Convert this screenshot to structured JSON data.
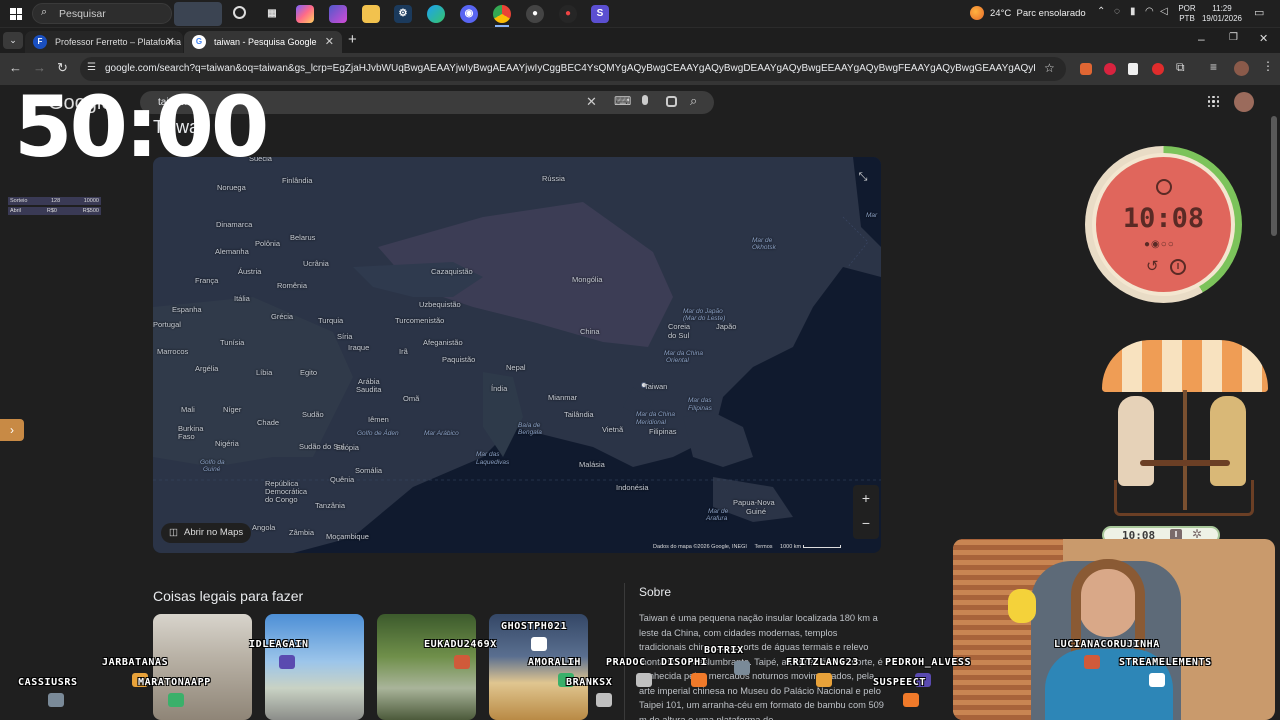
{
  "taskbar": {
    "search_placeholder": "Pesquisar",
    "weather": "24°C  Parc ensolarado",
    "lang_top": "POR",
    "lang_bottom": "PTB",
    "time": "11:29",
    "date": "19/01/2026"
  },
  "tabs": [
    {
      "label": "Professor Ferretto – Plataforma",
      "favicon": "F"
    },
    {
      "label": "taiwan - Pesquisa Google",
      "favicon": "G"
    }
  ],
  "address": {
    "url": "google.com/search?q=taiwan&oq=taiwan&gs_lcrp=EgZjaHJvbWUqBwgAEAAYjwIyBwgAEAAYjwIyCggBEC4YsQMYgAQyBwgCEAAYgAQyBwgDEAAYgAQyBwgEEAAYgAQyBwgFEAAYgAQyBwgGEAAYgAQyBwgHEAAYgAQyBwgIEA..."
  },
  "search": {
    "logo": "Google",
    "query": "taiwan"
  },
  "kp": {
    "title": "Taiwan"
  },
  "overlay": {
    "big_timer": "50:00",
    "stats": [
      [
        "Sorteio",
        "128",
        "10000"
      ],
      [
        "Abril",
        "R$0",
        "R$500"
      ]
    ],
    "pomodoro_time": "10:08",
    "mini_timer": "10:08"
  },
  "map": {
    "open_in_maps": "Abrir no Maps",
    "attribution": "Dados do mapa ©2026 Google, INEGI",
    "terms": "Termos",
    "scale": "1000 km",
    "labels": [
      [
        "Suécia",
        249,
        154,
        ""
      ],
      [
        "Finlândia",
        282,
        176,
        ""
      ],
      [
        "Rússia",
        542,
        174,
        ""
      ],
      [
        "Noruega",
        217,
        183,
        ""
      ],
      [
        "Dinamarca",
        216,
        220,
        ""
      ],
      [
        "Belarus",
        290,
        233,
        ""
      ],
      [
        "Polônia",
        255,
        239,
        ""
      ],
      [
        "Alemanha",
        215,
        247,
        ""
      ],
      [
        "Ucrânia",
        303,
        259,
        ""
      ],
      [
        "Áustria",
        238,
        267,
        ""
      ],
      [
        "Cazaquistão",
        431,
        267,
        ""
      ],
      [
        "França",
        195,
        276,
        ""
      ],
      [
        "Romênia",
        277,
        281,
        ""
      ],
      [
        "Mongólia",
        572,
        275,
        ""
      ],
      [
        "Itália",
        234,
        294,
        ""
      ],
      [
        "Uzbequistão",
        419,
        300,
        ""
      ],
      [
        "Espanha",
        172,
        305,
        ""
      ],
      [
        "Grécia",
        271,
        312,
        ""
      ],
      [
        "Turquia",
        318,
        316,
        ""
      ],
      [
        "Turcomenistão",
        395,
        316,
        ""
      ],
      [
        "Portugal",
        153,
        320,
        ""
      ],
      [
        "Coreia",
        668,
        322,
        ""
      ],
      [
        "do Sul",
        668,
        331,
        ""
      ],
      [
        "Japão",
        716,
        322,
        ""
      ],
      [
        "China",
        580,
        327,
        ""
      ],
      [
        "Tunísia",
        220,
        338,
        ""
      ],
      [
        "Síria",
        337,
        332,
        ""
      ],
      [
        "Iraque",
        348,
        343,
        ""
      ],
      [
        "Afeganistão",
        423,
        338,
        ""
      ],
      [
        "Irã",
        399,
        347,
        ""
      ],
      [
        "Marrocos",
        157,
        347,
        ""
      ],
      [
        "Paquistão",
        442,
        355,
        ""
      ],
      [
        "Argélia",
        195,
        364,
        ""
      ],
      [
        "Líbia",
        256,
        368,
        ""
      ],
      [
        "Egito",
        300,
        368,
        ""
      ],
      [
        "Nepal",
        506,
        363,
        ""
      ],
      [
        "Arábia",
        358,
        377,
        ""
      ],
      [
        "Saudita",
        356,
        385,
        ""
      ],
      [
        "Índia",
        491,
        384,
        ""
      ],
      [
        "Taiwan",
        644,
        382,
        ""
      ],
      [
        "Mianmar",
        548,
        393,
        ""
      ],
      [
        "Omã",
        403,
        394,
        ""
      ],
      [
        "Mali",
        181,
        405,
        ""
      ],
      [
        "Níger",
        223,
        405,
        ""
      ],
      [
        "Sudão",
        302,
        410,
        ""
      ],
      [
        "Tailândia",
        564,
        410,
        ""
      ],
      [
        "Mar da China",
        636,
        411,
        "sea"
      ],
      [
        "Meridional",
        636,
        419,
        "sea"
      ],
      [
        "Chade",
        257,
        418,
        ""
      ],
      [
        "Iêmen",
        368,
        415,
        ""
      ],
      [
        "Burkina",
        178,
        424,
        ""
      ],
      [
        "Faso",
        178,
        432,
        ""
      ],
      [
        "Vietnã",
        602,
        425,
        ""
      ],
      [
        "Filipinas",
        649,
        427,
        ""
      ],
      [
        "Nigéria",
        215,
        439,
        ""
      ],
      [
        "Sudão do Sul",
        299,
        442,
        ""
      ],
      [
        "Etiópia",
        336,
        443,
        ""
      ],
      [
        "Malásia",
        579,
        460,
        ""
      ],
      [
        "Somália",
        355,
        466,
        ""
      ],
      [
        "Quênia",
        330,
        475,
        ""
      ],
      [
        "Indonésia",
        616,
        483,
        ""
      ],
      [
        "República",
        265,
        479,
        ""
      ],
      [
        "Democrática",
        265,
        487,
        ""
      ],
      [
        "do Congo",
        265,
        495,
        ""
      ],
      [
        "Papua-Nova",
        733,
        498,
        ""
      ],
      [
        "Guiné",
        746,
        507,
        ""
      ],
      [
        "Tanzânia",
        315,
        501,
        ""
      ],
      [
        "Angola",
        252,
        523,
        ""
      ],
      [
        "Zâmbia",
        289,
        528,
        ""
      ],
      [
        "Moçambique",
        326,
        532,
        ""
      ],
      [
        "Mar Arábico",
        424,
        430,
        "sea"
      ],
      [
        "Baía de",
        518,
        422,
        "sea"
      ],
      [
        "Bengala",
        518,
        429,
        "sea"
      ],
      [
        "Mar das",
        688,
        397,
        "sea"
      ],
      [
        "Filipinas",
        688,
        405,
        "sea"
      ],
      [
        "Mar do Japão",
        683,
        308,
        "sea"
      ],
      [
        "(Mar do Leste)",
        683,
        315,
        "sea"
      ],
      [
        "Mar da China",
        664,
        350,
        "sea"
      ],
      [
        "Oriental",
        666,
        357,
        "sea"
      ],
      [
        "Mar de",
        752,
        237,
        "sea"
      ],
      [
        "Okhotsk",
        752,
        244,
        "sea"
      ],
      [
        "Mar",
        866,
        212,
        "sea"
      ],
      [
        "Golfo de Áden",
        357,
        430,
        "sea"
      ],
      [
        "Golfo da",
        200,
        459,
        "sea"
      ],
      [
        "Guiné",
        203,
        466,
        "sea"
      ],
      [
        "Mar das",
        476,
        451,
        "sea"
      ],
      [
        "Laquedivas",
        476,
        459,
        "sea"
      ],
      [
        "Mar de",
        708,
        508,
        "sea"
      ],
      [
        "Arafura",
        706,
        515,
        "sea"
      ]
    ]
  },
  "sections": {
    "things_title": "Coisas legais para fazer",
    "about_title": "Sobre",
    "about_text": "Taiwan é uma pequena nação insular localizada 180 km a leste da China, com cidades modernas, templos tradicionais chineses, resorts de águas termais e relevo montanhoso deslumbrante. Taipé, a capital, fica no norte, é conhecida pelos mercados noturnos movimentados, pela arte imperial chinesa no Museu do Palácio Nacional e pelo Taipei 101, um arranha-céu em formato de bambu com 509 m de altura e uma plataforma de"
  },
  "chat_names": [
    [
      "JARBATANAS",
      102,
      657
    ],
    [
      "IDLEAGAIN",
      249,
      639
    ],
    [
      "EUKADU2469X",
      424,
      639
    ],
    [
      "GHOSTPH021",
      501,
      621
    ],
    [
      "BOTRIX",
      704,
      645
    ],
    [
      "AMORALIH",
      528,
      657
    ],
    [
      "PRADOC",
      606,
      657
    ],
    [
      "DISOPHI",
      661,
      657
    ],
    [
      "FRITZLANG23",
      786,
      657
    ],
    [
      "PEDROH_ALVESS",
      885,
      657
    ],
    [
      "LUCIANACORUJINHA",
      1054,
      639
    ],
    [
      "STREAMELEMENTS",
      1119,
      657
    ],
    [
      "CASSIUSRS",
      18,
      677
    ],
    [
      "MARATONAAPP",
      138,
      677
    ],
    [
      "BRANKSX",
      566,
      677
    ],
    [
      "SUSPEECT",
      873,
      677
    ]
  ],
  "colors": {
    "accent": "#8ab4f8",
    "pomodoro_red": "#e0665c",
    "pomodoro_green": "#7cc35b",
    "map_land": "#2b3447",
    "map_china": "#3c3d55",
    "map_sea": "#101a2e"
  }
}
